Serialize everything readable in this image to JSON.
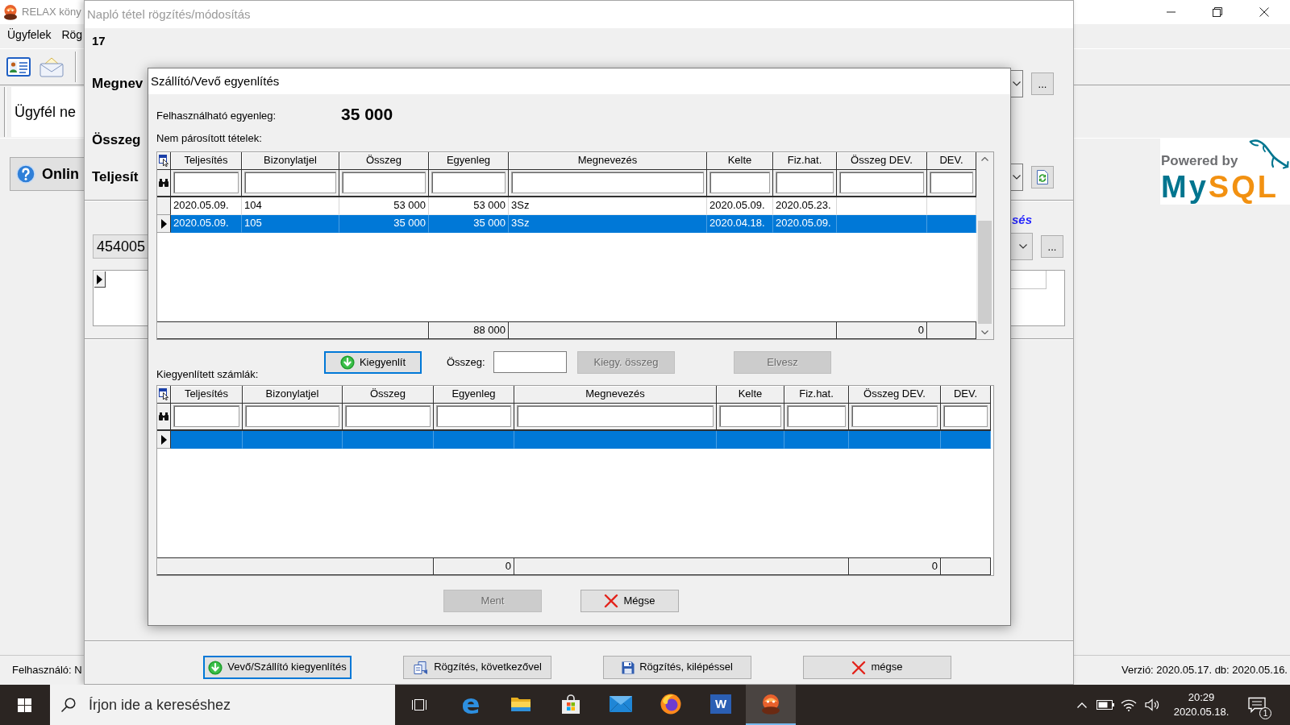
{
  "main_window": {
    "title": "RELAX köny",
    "menu": [
      "Ügyfelek",
      "Rög"
    ],
    "client_header": "Ügyfél ne",
    "online_button": "Onlin",
    "logo": {
      "caption": "Powered by",
      "wordmark": [
        {
          "text": "My",
          "color": "#00758f"
        },
        {
          "text": "SQL",
          "color": "#f29111"
        }
      ]
    },
    "status_bar": {
      "user": "Felhasználó: N",
      "version": "Verzió: 2020.05.17. db: 2020.05.16."
    }
  },
  "journal_window": {
    "title": "Napló tétel rögzítés/módosítás",
    "number": "17",
    "fields": [
      {
        "label": "Megnev",
        "kind": "lookup",
        "button": "..."
      },
      {
        "label": "Összeg",
        "kind": "plain"
      },
      {
        "label": "Teljesít",
        "kind": "refresh"
      }
    ],
    "link": "sés",
    "account": {
      "value": "454005",
      "button": "..."
    },
    "grid": {
      "rows": [
        {
          "selected": true
        }
      ]
    },
    "buttons": [
      {
        "label": "Vevő/Szállító kiegyenlítés",
        "kind": "settle",
        "focused": true
      },
      {
        "label": "Rögzítés, következővel",
        "kind": "save_next",
        "focused": false
      },
      {
        "label": "Rögzítés, kilépéssel",
        "kind": "save_exit",
        "focused": false
      },
      {
        "label": "mégse",
        "kind": "cancel",
        "focused": false
      }
    ]
  },
  "dialog": {
    "title": "Szállító/Vevő egyenlítés",
    "balance_label": "Felhasználható egyenleg:",
    "balance": "35 000",
    "open_items": {
      "caption": "Nem párosított tételek:",
      "columns": [
        {
          "title": "Teljesítés"
        },
        {
          "title": "Bizonylatjel"
        },
        {
          "title": "Összeg",
          "numeric": true
        },
        {
          "title": "Egyenleg",
          "numeric": true,
          "total": "88 000"
        },
        {
          "title": "Megnevezés"
        },
        {
          "title": "Kelte"
        },
        {
          "title": "Fiz.hat."
        },
        {
          "title": "Összeg DEV.",
          "total": "0"
        },
        {
          "title": "DEV."
        }
      ],
      "rows": [
        {
          "cells": [
            "2020.05.09.",
            "104",
            "53 000",
            "53 000",
            "3Sz",
            "2020.05.09.",
            "2020.05.23."
          ],
          "selected": false
        },
        {
          "cells": [
            "2020.05.09.",
            "105",
            "35 000",
            "35 000",
            "3Sz",
            "2020.04.18.",
            "2020.05.09."
          ],
          "selected": true
        }
      ]
    },
    "actions": [
      {
        "kind": "settle",
        "label": "Kiegyenlít",
        "focused": true,
        "disabled": false
      },
      {
        "kind": "amount",
        "label": "Összeg:",
        "focused": false,
        "disabled": false
      },
      {
        "kind": "partial",
        "label": "Kiegy. összeg",
        "focused": false,
        "disabled": true
      },
      {
        "kind": "remove",
        "label": "Elvesz",
        "focused": false,
        "disabled": true
      }
    ],
    "settled": {
      "caption": "Kiegyenlített számlák:",
      "columns": [
        {
          "title": "Teljesítés"
        },
        {
          "title": "Bizonylatjel"
        },
        {
          "title": "Összeg"
        },
        {
          "title": "Egyenleg",
          "total": "0"
        },
        {
          "title": "Megnevezés"
        },
        {
          "title": "Kelte"
        },
        {
          "title": "Fiz.hat."
        },
        {
          "title": "Összeg DEV.",
          "total": "0"
        },
        {
          "title": "DEV."
        }
      ],
      "rows": [
        {
          "selected": true
        }
      ]
    },
    "buttons": [
      {
        "label": "Ment",
        "kind": "save",
        "disabled": true
      },
      {
        "label": "Mégse",
        "kind": "cancel",
        "disabled": false
      }
    ]
  },
  "taskbar": {
    "search": {
      "placeholder": "Írjon ide a kereséshez"
    },
    "apps": [
      {
        "kind": "browser",
        "letter": "e",
        "selected": false
      },
      {
        "kind": "folder",
        "selected": false
      },
      {
        "kind": "store",
        "selected": false
      },
      {
        "kind": "mail",
        "selected": false
      },
      {
        "kind": "fox_globe",
        "selected": false
      },
      {
        "kind": "letter_tile",
        "letter": "W",
        "selected": false
      },
      {
        "kind": "app",
        "selected": true
      }
    ],
    "clock": {
      "time": "20:29",
      "date": "2020.05.18."
    },
    "notifications": "1"
  }
}
